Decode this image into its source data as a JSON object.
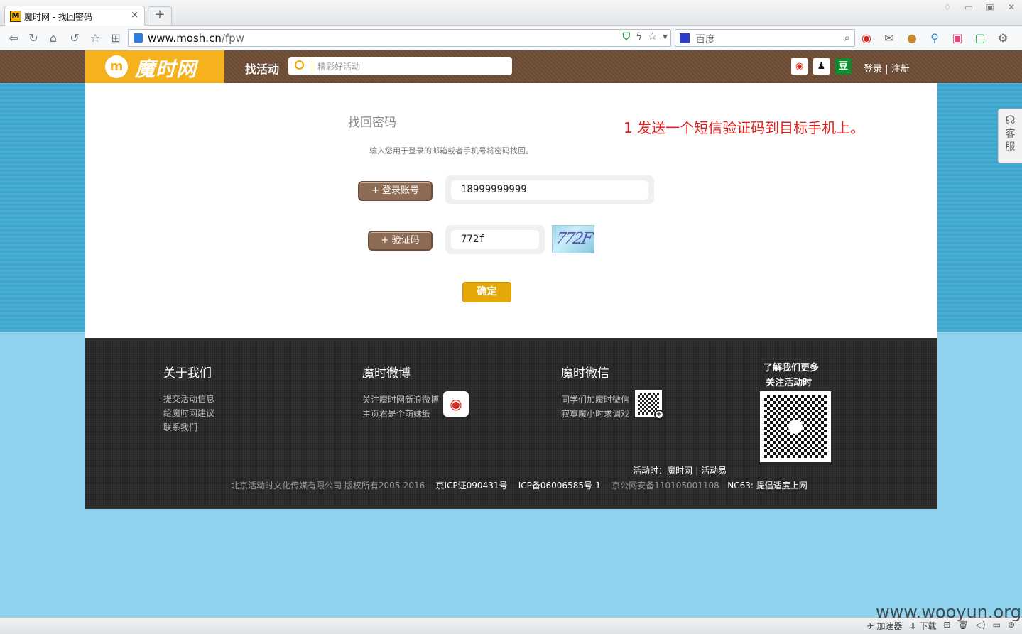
{
  "browser": {
    "tab_title": "魔时网 - 找回密码",
    "tab_favicon": "M",
    "tab_close": "×",
    "new_tab": "+",
    "url_host": "www.mosh.cn",
    "url_path": "/fpw",
    "search_engine": "百度",
    "status_items": [
      "加速器",
      "下载"
    ]
  },
  "site": {
    "logo_text": "魔时网",
    "logo_icon": "m",
    "find_label": "找活动",
    "search_placeholder": "精彩好活动",
    "login": "登录",
    "register": "注册",
    "auth_sep": "|",
    "social_icons": [
      "weibo-icon",
      "qq-icon",
      "douban-icon"
    ],
    "douban_glyph": "豆"
  },
  "form": {
    "title": "找回密码",
    "annotation": "1 发送一个短信验证码到目标手机上。",
    "instruction": "输入您用于登录的邮箱或者手机号将密码找回。",
    "account_label": "+ 登录账号",
    "account_value": "18999999999",
    "code_label": "+ 验证码",
    "code_value": "772f",
    "captcha_text": "772F",
    "submit_label": "确定"
  },
  "footer": {
    "about_title": "关于我们",
    "about_links": [
      "提交活动信息",
      "给魔时网建议",
      "联系我们"
    ],
    "weibo_title": "魔时微博",
    "weibo_lines": [
      "关注魔时网新浪微博",
      "主页君是个萌妹纸"
    ],
    "wechat_title": "魔时微信",
    "wechat_lines": [
      "同学们加魔时微信",
      "寂寞魔小时求调戏"
    ],
    "learn_more": [
      "了解我们更多",
      "关注活动时"
    ],
    "brands": [
      "活动时：魔时网",
      "活动易"
    ],
    "copyright": "北京活动时文化传媒有限公司 版权所有2005-2016",
    "icp1": "京ICP证090431号",
    "icp2": "ICP备06006585号-1",
    "police": "京公网安备110105001108",
    "nc": "NC63: 提倡适度上网"
  },
  "service": {
    "line1": "客",
    "line2": "服"
  },
  "watermark": "www.wooyun.org",
  "colors": {
    "brand_yellow": "#f5b21c",
    "header_brown": "#6b4a33",
    "annotation_red": "#e02020",
    "label_brown": "#8d6b55",
    "button_gold": "#e5a80b"
  }
}
